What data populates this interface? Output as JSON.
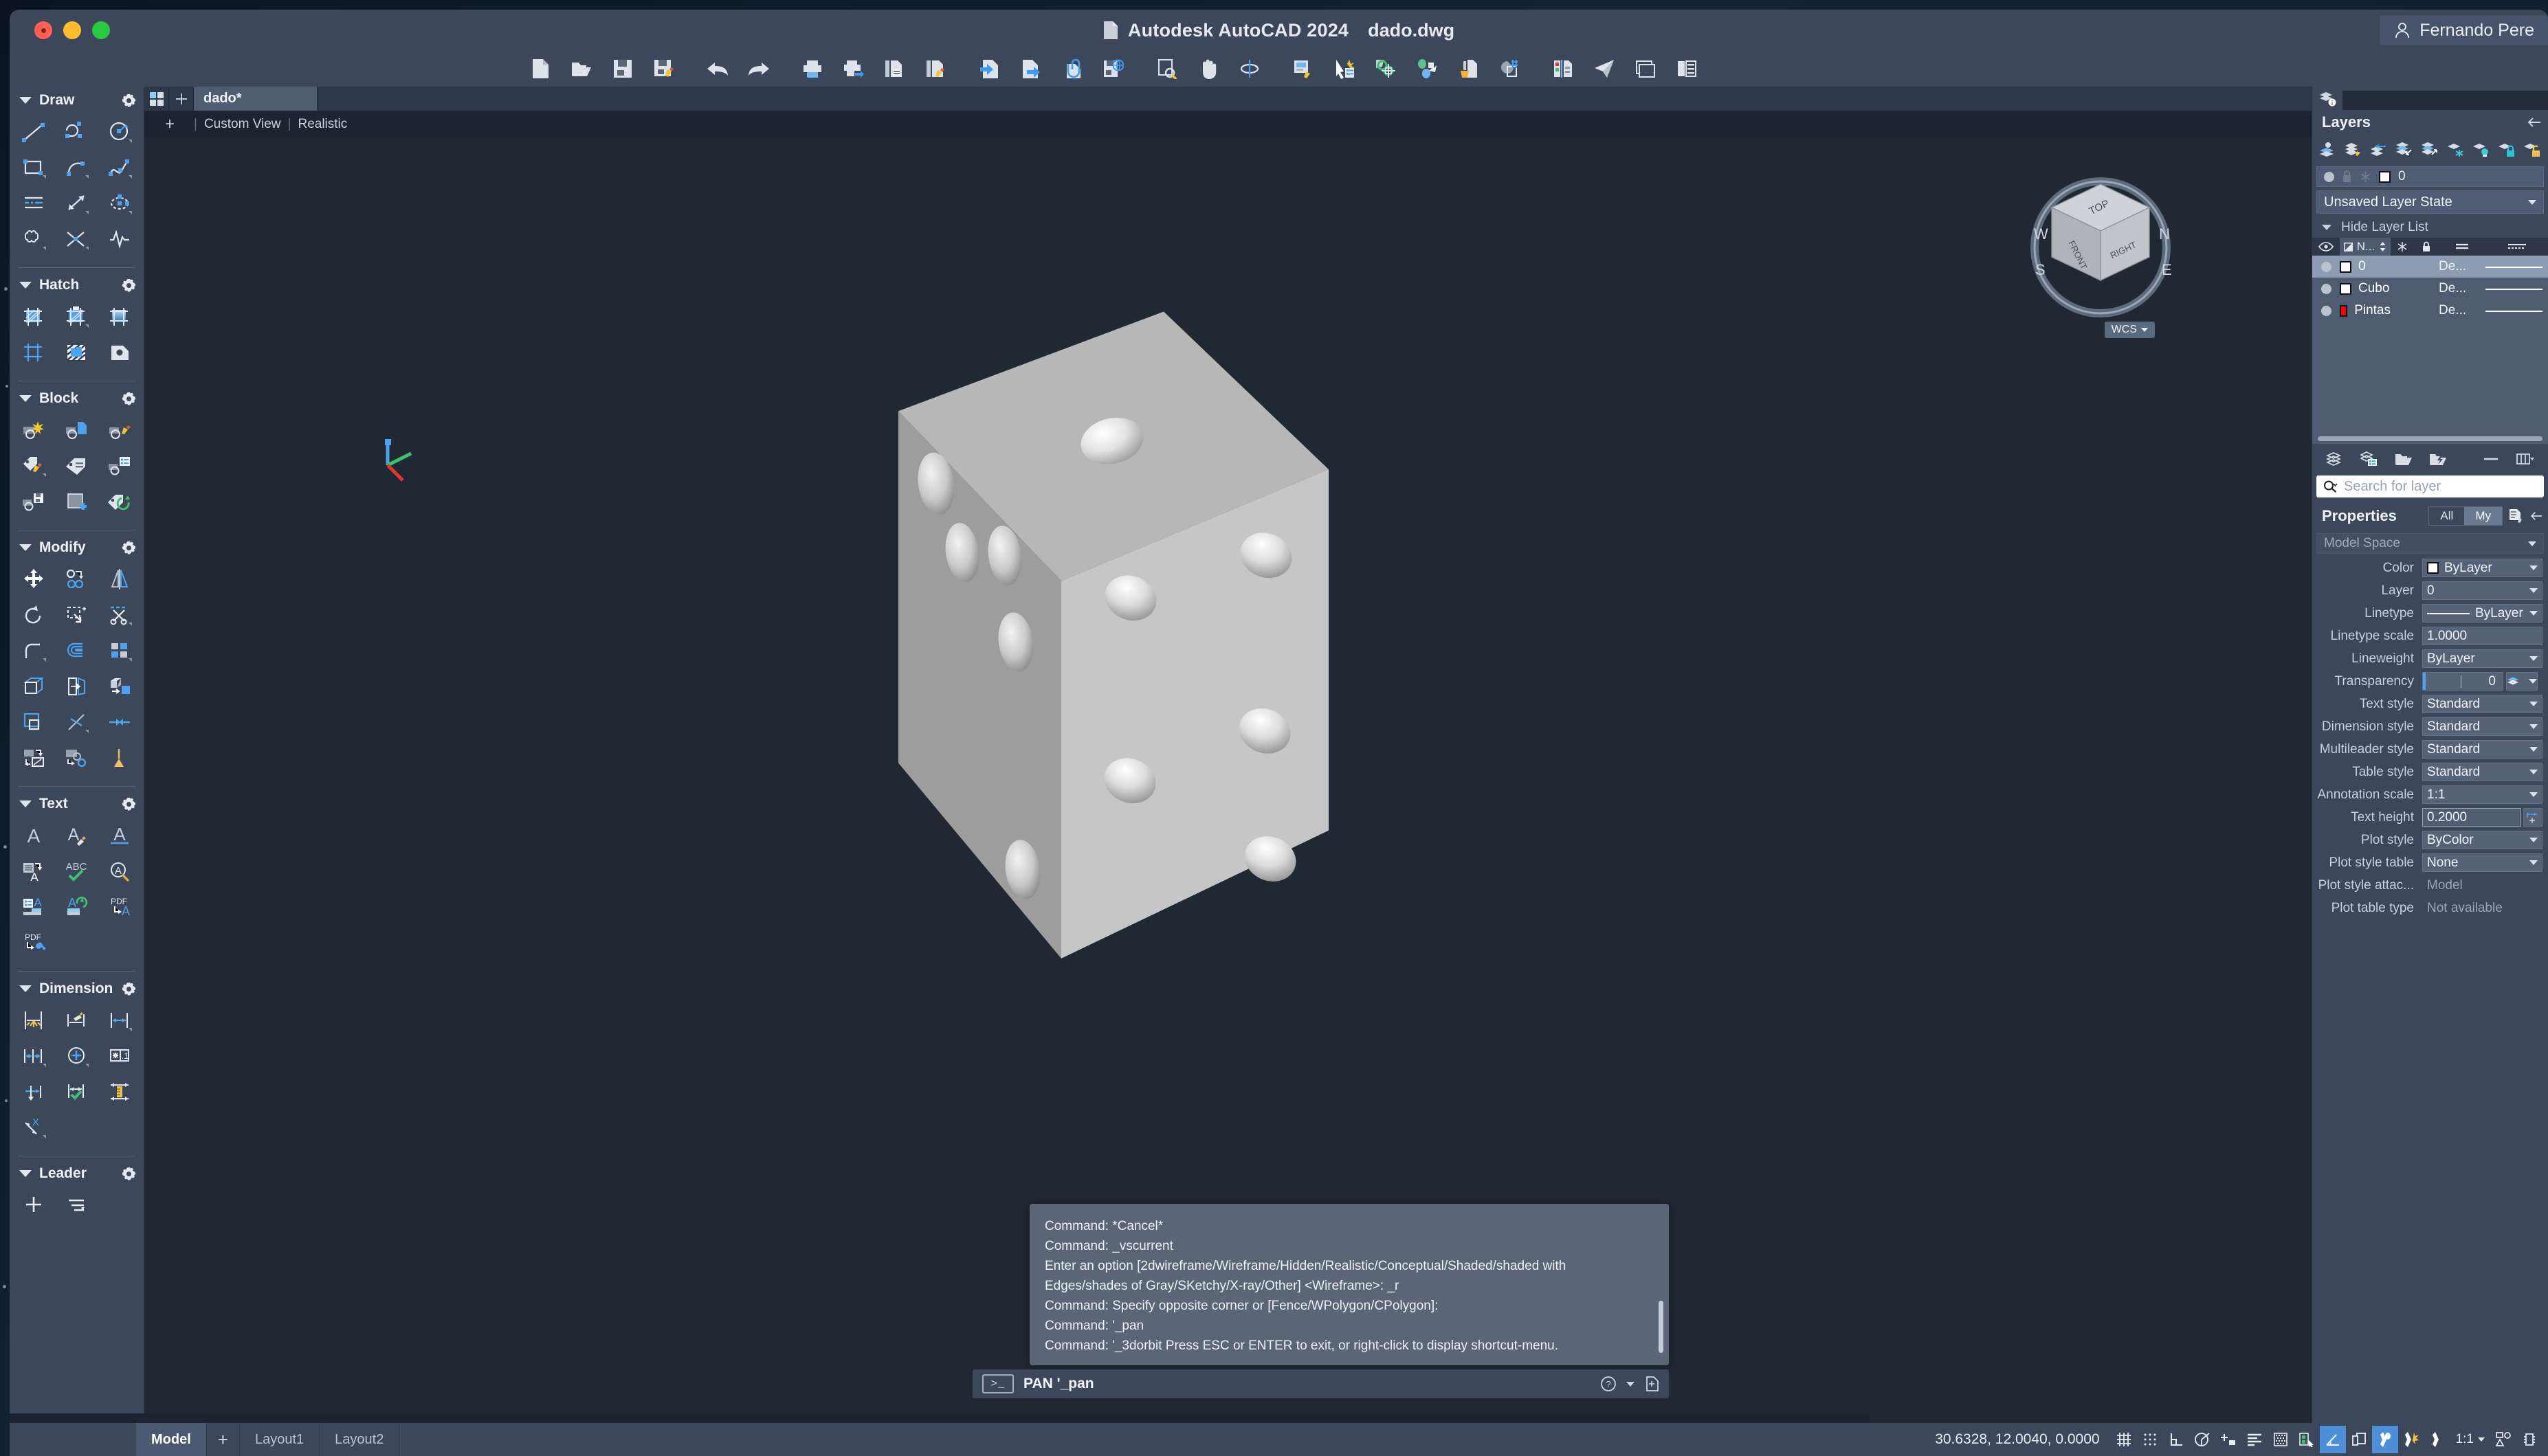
{
  "window": {
    "title": "Autodesk AutoCAD 2024",
    "file": "dado.dwg",
    "user": "Fernando Pere",
    "traffic": [
      "close",
      "minimize",
      "maximize"
    ]
  },
  "toolbar": {
    "groups": [
      {
        "items": [
          {
            "name": "new-file-icon",
            "label": "New"
          },
          {
            "name": "open-folder-icon",
            "label": "Open"
          },
          {
            "name": "save-icon",
            "label": "Save"
          },
          {
            "name": "save-as-icon",
            "label": "Save As"
          }
        ]
      },
      {
        "items": [
          {
            "name": "undo-icon",
            "label": "Undo"
          },
          {
            "name": "redo-icon",
            "label": "Redo"
          }
        ]
      },
      {
        "items": [
          {
            "name": "plot-icon",
            "label": "Plot"
          },
          {
            "name": "plot-preview-icon",
            "label": "Plot Preview"
          },
          {
            "name": "batch-plot-icon",
            "label": "Batch Plot"
          },
          {
            "name": "page-setup-icon",
            "label": "Page Setup Manager"
          }
        ]
      },
      {
        "items": [
          {
            "name": "import-icon",
            "label": "Import"
          },
          {
            "name": "export-icon",
            "label": "Export"
          },
          {
            "name": "attach-icon",
            "label": "Attach"
          },
          {
            "name": "save-web-icon",
            "label": "Save to Web & Mobile"
          }
        ]
      },
      {
        "items": [
          {
            "name": "zoom-window-icon",
            "label": "Zoom"
          },
          {
            "name": "pan-icon",
            "label": "Pan"
          },
          {
            "name": "orbit-icon",
            "label": "Orbit"
          }
        ]
      },
      {
        "items": [
          {
            "name": "layer-properties-icon",
            "label": "Layer Properties"
          },
          {
            "name": "quick-select-icon",
            "label": "Quick Select"
          },
          {
            "name": "object-snap-icon",
            "label": "Object Snap Settings"
          },
          {
            "name": "match-properties-icon",
            "label": "Match Properties"
          },
          {
            "name": "purge-icon",
            "label": "Purge"
          },
          {
            "name": "hatch-count-icon",
            "label": "Measure Geometry"
          }
        ]
      },
      {
        "items": [
          {
            "name": "layer-manager-icon",
            "label": "Layer Manager"
          },
          {
            "name": "share-icon",
            "label": "Share"
          },
          {
            "name": "sheet-set-icon",
            "label": "Sheet Set Manager"
          },
          {
            "name": "properties-icon",
            "label": "Properties"
          }
        ]
      }
    ]
  },
  "drawing_tabs": {
    "grid_button": "layout-grid-icon",
    "add_button": "+",
    "tabs": [
      {
        "label": "dado*",
        "active": true
      }
    ]
  },
  "viewport_header": {
    "plus": "+",
    "view": "Custom View",
    "visual_style": "Realistic"
  },
  "viewcube": {
    "faces": [
      "TOP",
      "FRONT",
      "RIGHT"
    ],
    "compass": [
      "N",
      "E",
      "S",
      "W"
    ],
    "wcs_label": "WCS"
  },
  "left_palette": {
    "sections": [
      {
        "title": "Draw",
        "gear": "gear-icon",
        "tools": [
          "line-icon",
          "polyline-icon",
          "circle-icon",
          "rectangle-icon",
          "arc-icon",
          "spline-icon",
          "construction-line-icon",
          "ray-icon",
          "ellipse-icon",
          "revision-cloud-icon",
          "xline-icon",
          "polyline-edit-icon"
        ]
      },
      {
        "title": "Hatch",
        "gear": "gear-icon",
        "tools": [
          "hatch-icon",
          "hatch-settings-icon",
          "gradient-icon",
          "boundary-icon",
          "hatch-region-icon",
          "wipeout-icon"
        ]
      },
      {
        "title": "Block",
        "gear": "gear-icon",
        "tools": [
          "insert-block-icon",
          "create-block-icon",
          "block-editor-icon",
          "edit-attribute-icon",
          "define-attribute-icon",
          "attribute-table-icon",
          "write-block-icon",
          "block-base-point-icon",
          "sync-attributes-icon"
        ]
      },
      {
        "title": "Modify",
        "gear": "gear-icon",
        "tools": [
          "move-icon",
          "copy-icon",
          "mirror-icon",
          "rotate-icon",
          "scale-icon",
          "trim-icon",
          "fillet-icon",
          "offset-icon",
          "array-icon",
          "extrude-icon",
          "presspull-icon",
          "solid-edit-icon",
          "stretch-icon",
          "extend-icon",
          "join-icon",
          "explode-icon",
          "align-icon",
          "erase-brush-icon"
        ]
      },
      {
        "title": "Text",
        "gear": "gear-icon",
        "tools": [
          "single-line-text-icon",
          "text-style-icon",
          "text-underline-icon",
          "multiline-text-icon",
          "spell-check-icon",
          "find-text-icon",
          "text-to-table-icon",
          "text-update-icon",
          "pdf-text-icon",
          "pdf-tools-icon"
        ]
      },
      {
        "title": "Dimension",
        "gear": "gear-icon",
        "tools": [
          "quick-dimension-icon",
          "dimension-style-icon",
          "linear-dimension-icon",
          "baseline-dimension-icon",
          "center-mark-icon",
          "tolerance-icon",
          "jogged-dimension-icon",
          "dimension-check-icon",
          "measure-icon",
          "dimension-break-icon"
        ]
      },
      {
        "title": "Leader",
        "gear": "gear-icon",
        "tools": [
          "add-leader-icon",
          "align-leader-icon"
        ]
      }
    ]
  },
  "layers_panel": {
    "tab_icon": "layers-info-icon",
    "title": "Layers",
    "collapse_icon": "collapse-left-icon",
    "tools": [
      "make-current-icon",
      "layer-properties-icon",
      "previous-layer-icon",
      "layer-off-icon",
      "layer-isolate-icon",
      "freeze-icon",
      "turn-on-layers-icon",
      "lock-layer-icon",
      "unlock-layer-icon"
    ],
    "current_layer": {
      "on_icon": "lightbulb-dot-icon",
      "lock_icon": "lock-icon",
      "freeze_icon": "snowflake-icon",
      "color_swatch": "#ffffff",
      "name": "0"
    },
    "layer_state": "Unsaved Layer State",
    "hide_list_label": "Hide Layer List",
    "table": {
      "columns": [
        "on",
        "N...",
        "freeze",
        "lock",
        "plot",
        "linetype"
      ],
      "sort_column": "N...",
      "rows": [
        {
          "name": "0",
          "color": "#ffffff",
          "plot": "De...",
          "selected": true
        },
        {
          "name": "Cubo",
          "color": "#ffffff",
          "plot": "De...",
          "selected": false
        },
        {
          "name": "Pintas",
          "color": "#ff0000",
          "plot": "De...",
          "selected": false
        }
      ]
    },
    "bottom_tools": [
      "new-layer-icon",
      "layer-states-icon",
      "layer-folder-icon",
      "layer-filter-icon",
      "minimize-icon",
      "columns-icon"
    ],
    "search_placeholder": "Search for layer",
    "search_icon": "search-icon"
  },
  "properties_panel": {
    "title": "Properties",
    "filter_all": "All",
    "filter_my": "My",
    "filter_selected": "My",
    "quick_props_icon": "quick-properties-icon",
    "collapse_icon": "collapse-left-icon",
    "scope": "Model Space",
    "rows": [
      {
        "label": "Color",
        "value": "ByLayer",
        "type": "color",
        "swatch": "#ffffff"
      },
      {
        "label": "Layer",
        "value": "0",
        "type": "combo"
      },
      {
        "label": "Linetype",
        "value": "ByLayer",
        "type": "linetype"
      },
      {
        "label": "Linetype scale",
        "value": "1.0000",
        "type": "text"
      },
      {
        "label": "Lineweight",
        "value": "ByLayer",
        "type": "combo"
      },
      {
        "label": "Transparency",
        "value": "0",
        "type": "slider"
      },
      {
        "label": "Text style",
        "value": "Standard",
        "type": "combo"
      },
      {
        "label": "Dimension style",
        "value": "Standard",
        "type": "combo"
      },
      {
        "label": "Multileader style",
        "value": "Standard",
        "type": "combo"
      },
      {
        "label": "Table style",
        "value": "Standard",
        "type": "combo"
      },
      {
        "label": "Annotation scale",
        "value": "1:1",
        "type": "combo"
      },
      {
        "label": "Text height",
        "value": "0.2000",
        "type": "edit"
      },
      {
        "label": "Plot style",
        "value": "ByColor",
        "type": "combo"
      },
      {
        "label": "Plot style table",
        "value": "None",
        "type": "combo"
      },
      {
        "label": "Plot style attac...",
        "value": "Model",
        "type": "readonly"
      },
      {
        "label": "Plot table type",
        "value": "Not available",
        "type": "readonly"
      }
    ]
  },
  "command_window": {
    "history": [
      "Command: *Cancel*",
      "Command: _vscurrent",
      "Enter an option [2dwireframe/Wireframe/Hidden/Realistic/Conceptual/Shaded/shaded with",
      "Edges/shades of Gray/SKetchy/X-ray/Other] <Wireframe>: _r",
      "Command: Specify opposite corner or [Fence/WPolygon/CPolygon]:",
      "Command: '_pan",
      "Command: '_3dorbit Press ESC or ENTER to exit, or right-click to display shortcut-menu."
    ],
    "prompt_icon": ">_",
    "current": "PAN '_pan",
    "help_icon": "help-icon",
    "customize_icon": "customize-icon"
  },
  "status_bar": {
    "layout_tabs": [
      {
        "label": "Model",
        "active": true
      },
      {
        "label": "+",
        "active": false
      },
      {
        "label": "Layout1",
        "active": false
      },
      {
        "label": "Layout2",
        "active": false
      }
    ],
    "coordinates": "30.6328,  12.0040, 0.0000",
    "annotation_scale": "1:1",
    "toggles": [
      {
        "name": "grid-display-icon",
        "on": false
      },
      {
        "name": "snap-mode-icon",
        "on": false
      },
      {
        "name": "ortho-mode-icon",
        "on": false
      },
      {
        "name": "polar-tracking-icon",
        "on": false
      },
      {
        "name": "object-snap-icon",
        "on": false
      },
      {
        "name": "object-snap-tracking-icon",
        "on": false
      },
      {
        "name": "lineweight-icon",
        "on": false
      },
      {
        "name": "selection-cycling-icon",
        "on": false
      },
      {
        "name": "dynamic-ucs-icon",
        "on": true
      },
      {
        "name": "dynamic-input-icon",
        "on": false
      },
      {
        "name": "annotation-visibility-icon",
        "on": true
      },
      {
        "name": "autoscale-icon",
        "on": false
      },
      {
        "name": "annotation-scale-icon",
        "on": false
      }
    ],
    "right_extra": [
      "workspace-icon",
      "hardware-accel-icon"
    ]
  }
}
